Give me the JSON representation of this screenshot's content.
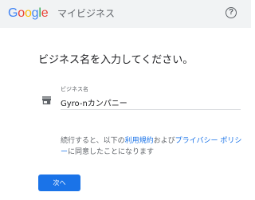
{
  "header": {
    "logo_letters": [
      "G",
      "o",
      "o",
      "g",
      "l",
      "e"
    ],
    "product_name": "マイビジネス",
    "help_icon": "help-circle-icon",
    "help_glyph": "?"
  },
  "main": {
    "title": "ビジネス名を入力してください。",
    "field_icon": "storefront-icon",
    "field_label": "ビジネス名",
    "field_value": "Gyro-nカンパニー",
    "terms": {
      "prefix": "続行すると、以下の",
      "terms_link": "利用規約",
      "middle": "および",
      "privacy_link": "プライバシー ポリシー",
      "suffix": "に同意したことになります"
    },
    "next_label": "次へ"
  },
  "colors": {
    "header_bg": "#f1f3f4",
    "accent": "#1a73e8",
    "text": "#202124",
    "secondary_text": "#5f6368"
  }
}
